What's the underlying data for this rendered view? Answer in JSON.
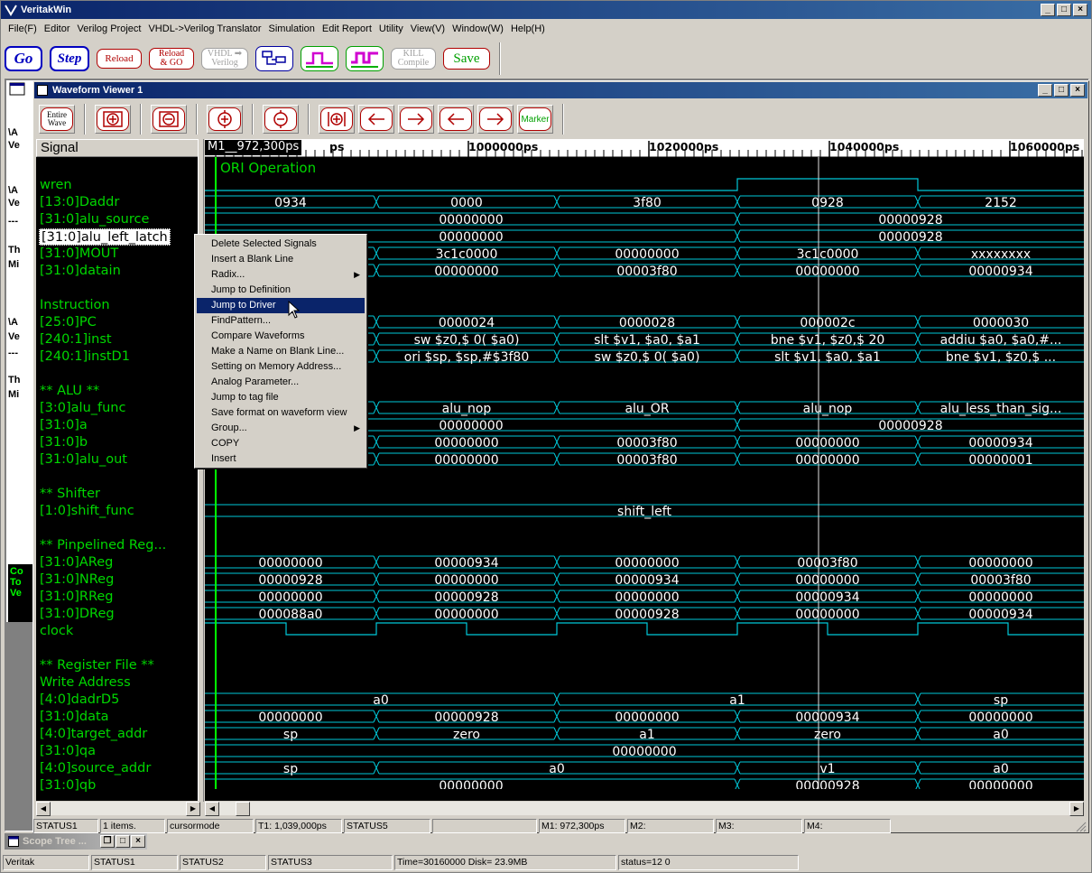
{
  "app": {
    "title": "VeritakWin",
    "menu": [
      "File(F)",
      "Editor",
      "Verilog Project",
      "VHDL->Verilog Translator",
      "Simulation",
      "Edit Report",
      "Utility",
      "View(V)",
      "Window(W)",
      "Help(H)"
    ]
  },
  "toolbar": {
    "go": "Go",
    "step": "Step",
    "reload": "Reload",
    "reload_go_1": "Reload",
    "reload_go_2": "& GO",
    "vhdl_1": "VHDL",
    "vhdl_2": "Verilog",
    "kill_1": "KILL",
    "kill_2": "Compile",
    "save": "Save"
  },
  "behind_window": {
    "lines": [
      "\\A",
      "Ve",
      "\\A",
      "Ve",
      "---",
      "Th",
      "Mi",
      "\\A",
      "Ve",
      "---",
      "Th",
      "Mi"
    ],
    "green_lines": [
      "Co",
      "To",
      "Ve"
    ]
  },
  "waveform": {
    "title": "Waveform Viewer 1",
    "tools": {
      "entire_1": "Entire",
      "entire_2": "Wave",
      "marker": "Marker"
    },
    "signal_header": "Signal",
    "marker_label": "M1__972,300ps",
    "ruler": [
      {
        "label": "ps"
      },
      {
        "label": "1000000ps"
      },
      {
        "label": "1020000ps"
      },
      {
        "label": "1040000ps"
      },
      {
        "label": "1060000ps"
      }
    ],
    "comment_text": "ORI Operation",
    "signals": [
      {
        "name": "",
        "kind": "comment"
      },
      {
        "name": "wren",
        "kind": "bit",
        "levels": [
          0,
          0,
          0,
          1,
          0
        ]
      },
      {
        "name": "[13:0]Daddr",
        "kind": "bus",
        "values": [
          "0934",
          "0000",
          "3f80",
          "0928",
          "2152"
        ]
      },
      {
        "name": "[31:0]alu_source",
        "kind": "bus2",
        "values": [
          "00000000",
          "00000928"
        ]
      },
      {
        "name": "[31:0]alu_left_latch",
        "kind": "bus2",
        "values": [
          "00000000",
          "00000928"
        ],
        "selected": true
      },
      {
        "name": "[31:0]MOUT",
        "kind": "bus",
        "values": [
          "",
          "3c1c0000",
          "00000000",
          "3c1c0000",
          "xxxxxxxx"
        ]
      },
      {
        "name": "[31:0]datain",
        "kind": "bus",
        "values": [
          "",
          "00000000",
          "00003f80",
          "00000000",
          "00000934"
        ]
      },
      {
        "name": "",
        "kind": "blank"
      },
      {
        "name": "Instruction",
        "kind": "section"
      },
      {
        "name": "[25:0]PC",
        "kind": "bus",
        "values": [
          "",
          "0000024",
          "0000028",
          "000002c",
          "0000030"
        ]
      },
      {
        "name": "[240:1]inst",
        "kind": "bus",
        "values": [
          "",
          "sw $z0,$  0( $a0)",
          "slt $v1, $a0, $a1",
          "bne $v1, $z0,$     20",
          "addiu $a0, $a0,#..."
        ]
      },
      {
        "name": "[240:1]instD1",
        "kind": "bus",
        "values": [
          "",
          "ori $sp, $sp,#$3f80",
          "sw $z0,$  0( $a0)",
          "slt $v1, $a0, $a1",
          "bne $v1, $z0,$  ..."
        ]
      },
      {
        "name": "",
        "kind": "blank"
      },
      {
        "name": "** ALU **",
        "kind": "section"
      },
      {
        "name": "[3:0]alu_func",
        "kind": "bus",
        "values": [
          "",
          "alu_nop",
          "alu_OR",
          "alu_nop",
          "alu_less_than_sig..."
        ]
      },
      {
        "name": "[31:0]a",
        "kind": "bus2",
        "values": [
          "00000000",
          "00000928"
        ]
      },
      {
        "name": "[31:0]b",
        "kind": "bus",
        "values": [
          "",
          "00000000",
          "00003f80",
          "00000000",
          "00000934"
        ]
      },
      {
        "name": "[31:0]alu_out",
        "kind": "bus",
        "values": [
          "",
          "00000000",
          "00003f80",
          "00000000",
          "00000001"
        ]
      },
      {
        "name": "",
        "kind": "blank"
      },
      {
        "name": "** Shifter",
        "kind": "section"
      },
      {
        "name": "[1:0]shift_func",
        "kind": "bus1",
        "values": [
          "shift_left"
        ]
      },
      {
        "name": "",
        "kind": "blank"
      },
      {
        "name": "** Pinpelined Reg...",
        "kind": "section"
      },
      {
        "name": "[31:0]AReg",
        "kind": "bus",
        "values": [
          "00000000",
          "00000934",
          "00000000",
          "00003f80",
          "00000000"
        ]
      },
      {
        "name": "[31:0]NReg",
        "kind": "bus",
        "values": [
          "00000928",
          "00000000",
          "00000934",
          "00000000",
          "00003f80"
        ]
      },
      {
        "name": "[31:0]RReg",
        "kind": "bus",
        "values": [
          "00000000",
          "00000928",
          "00000000",
          "00000934",
          "00000000"
        ]
      },
      {
        "name": "[31:0]DReg",
        "kind": "bus",
        "values": [
          "000088a0",
          "00000000",
          "00000928",
          "00000000",
          "00000934"
        ]
      },
      {
        "name": "clock",
        "kind": "clock"
      },
      {
        "name": "",
        "kind": "blank"
      },
      {
        "name": "** Register File **",
        "kind": "section"
      },
      {
        "name": " Write Address",
        "kind": "section"
      },
      {
        "name": "[4:0]dadrD5",
        "kind": "busA",
        "values": [
          "a0",
          "a1",
          "sp"
        ]
      },
      {
        "name": "[31:0]data",
        "kind": "bus",
        "values": [
          "00000000",
          "00000928",
          "00000000",
          "00000934",
          "00000000"
        ]
      },
      {
        "name": "[4:0]target_addr",
        "kind": "bus",
        "values": [
          "sp",
          "zero",
          "a1",
          "zero",
          "a0"
        ]
      },
      {
        "name": "[31:0]qa",
        "kind": "bus1",
        "values": [
          "00000000"
        ]
      },
      {
        "name": "[4:0]source_addr",
        "kind": "busB",
        "values": [
          "sp",
          "a0",
          "v1",
          "a0"
        ]
      },
      {
        "name": "[31:0]qb",
        "kind": "busC",
        "values": [
          "00000000",
          "00000928",
          "00000000"
        ]
      }
    ],
    "status": [
      "STATUS1",
      "1 items.",
      "cursormode",
      "T1: 1,039,000ps",
      "STATUS5",
      "",
      "M1: 972,300ps",
      "M2:",
      "M3:",
      "M4:"
    ]
  },
  "context_menu": {
    "items": [
      {
        "label": "Delete Selected Signals"
      },
      {
        "label": "Insert a Blank Line"
      },
      {
        "label": "Radix...",
        "submenu": true
      },
      {
        "label": "Jump to Definition"
      },
      {
        "label": "Jump to Driver",
        "highlighted": true
      },
      {
        "label": "FindPattern..."
      },
      {
        "label": "Compare Waveforms"
      },
      {
        "label": "Make a Name on Blank Line..."
      },
      {
        "label": "Setting on Memory Address..."
      },
      {
        "label": "Analog Parameter..."
      },
      {
        "label": "Jump to tag file"
      },
      {
        "label": "Save format on waveform view"
      },
      {
        "label": "Group...",
        "submenu": true
      },
      {
        "label": "COPY"
      },
      {
        "label": "Insert"
      }
    ]
  },
  "scope_tree": {
    "title": "Scope Tree ..."
  },
  "main_status": [
    "Veritak",
    "STATUS1",
    "STATUS2",
    "STATUS3",
    "Time=30160000 Disk= 23.9MB",
    "status=12 0"
  ]
}
